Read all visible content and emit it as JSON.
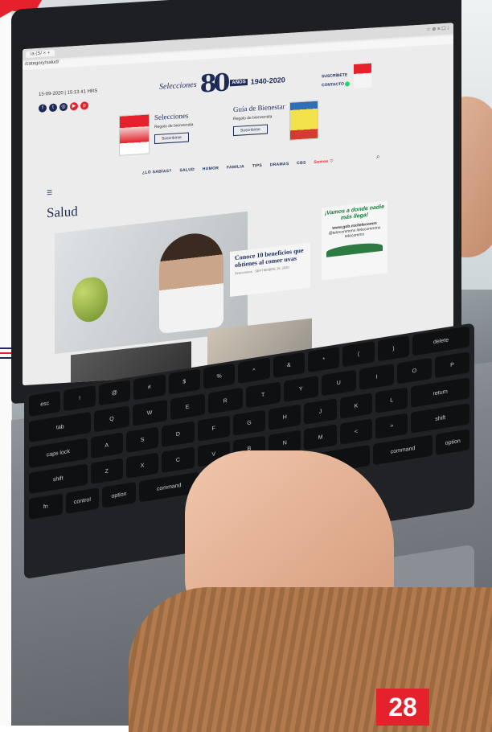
{
  "browser": {
    "tab_label": "ia (S/ ×  +",
    "url": "/category/salud/",
    "toolbar_icons": "☆  ⊕  ≡  ☐  ⁞"
  },
  "site": {
    "date": "15-09-2020 | 15:13 41 HRS",
    "logo_word": "Selecciones",
    "logo_number": "80",
    "logo_anos": "AÑOS",
    "logo_years": "1940-2020",
    "suscribete": "SUSCRÍBETE",
    "contacto": "CONTACTO",
    "social_icons": [
      "facebook-icon",
      "twitter-icon",
      "instagram-icon",
      "youtube-icon",
      "pinterest-icon"
    ]
  },
  "promos": [
    {
      "title": "Selecciones",
      "subtitle": "Regalo de bienvenida",
      "button": "Suscribirse",
      "cover": "CURA REAL"
    },
    {
      "title": "Guía de Bienestar",
      "subtitle": "Regalo de bienvenida",
      "button": "Suscribirse",
      "cover": "CÁNCER Detectalo a tiempo"
    }
  ],
  "nav": {
    "items": [
      "¿LO SABÍAS?",
      "SALUD",
      "HUMOR",
      "FAMILIA",
      "TIPS",
      "DRAMAS",
      "CBS"
    ],
    "special": "Somos ♡"
  },
  "section_title": "Salud",
  "featured": {
    "title": "Conoce 10 beneficios que obtienes al comer uvas",
    "meta": "Selecciones · SEPTIEMBRE 15, 2020"
  },
  "ad": {
    "headline": "¡Vamos a donde nadie más llega!",
    "url": "www.gob.mx/telecomm",
    "social1": "@telecommmx",
    "social2": "/telecommmx",
    "social3": "telecommx"
  },
  "keyboard": {
    "row1": [
      "esc",
      "!",
      "@",
      "#",
      "$",
      "%",
      "^",
      "&",
      "*",
      "(",
      ")",
      "delete"
    ],
    "row2": [
      "tab",
      "Q",
      "W",
      "E",
      "R",
      "T",
      "Y",
      "U",
      "I",
      "O",
      "P"
    ],
    "row3": [
      "caps lock",
      "A",
      "S",
      "D",
      "F",
      "G",
      "H",
      "J",
      "K",
      "L",
      "return"
    ],
    "row4": [
      "shift",
      "Z",
      "X",
      "C",
      "V",
      "B",
      "N",
      "M",
      "<",
      ">",
      "shift"
    ],
    "row5": [
      "fn",
      "control",
      "option",
      "command",
      "",
      "command",
      "option"
    ]
  },
  "page_number": "28"
}
